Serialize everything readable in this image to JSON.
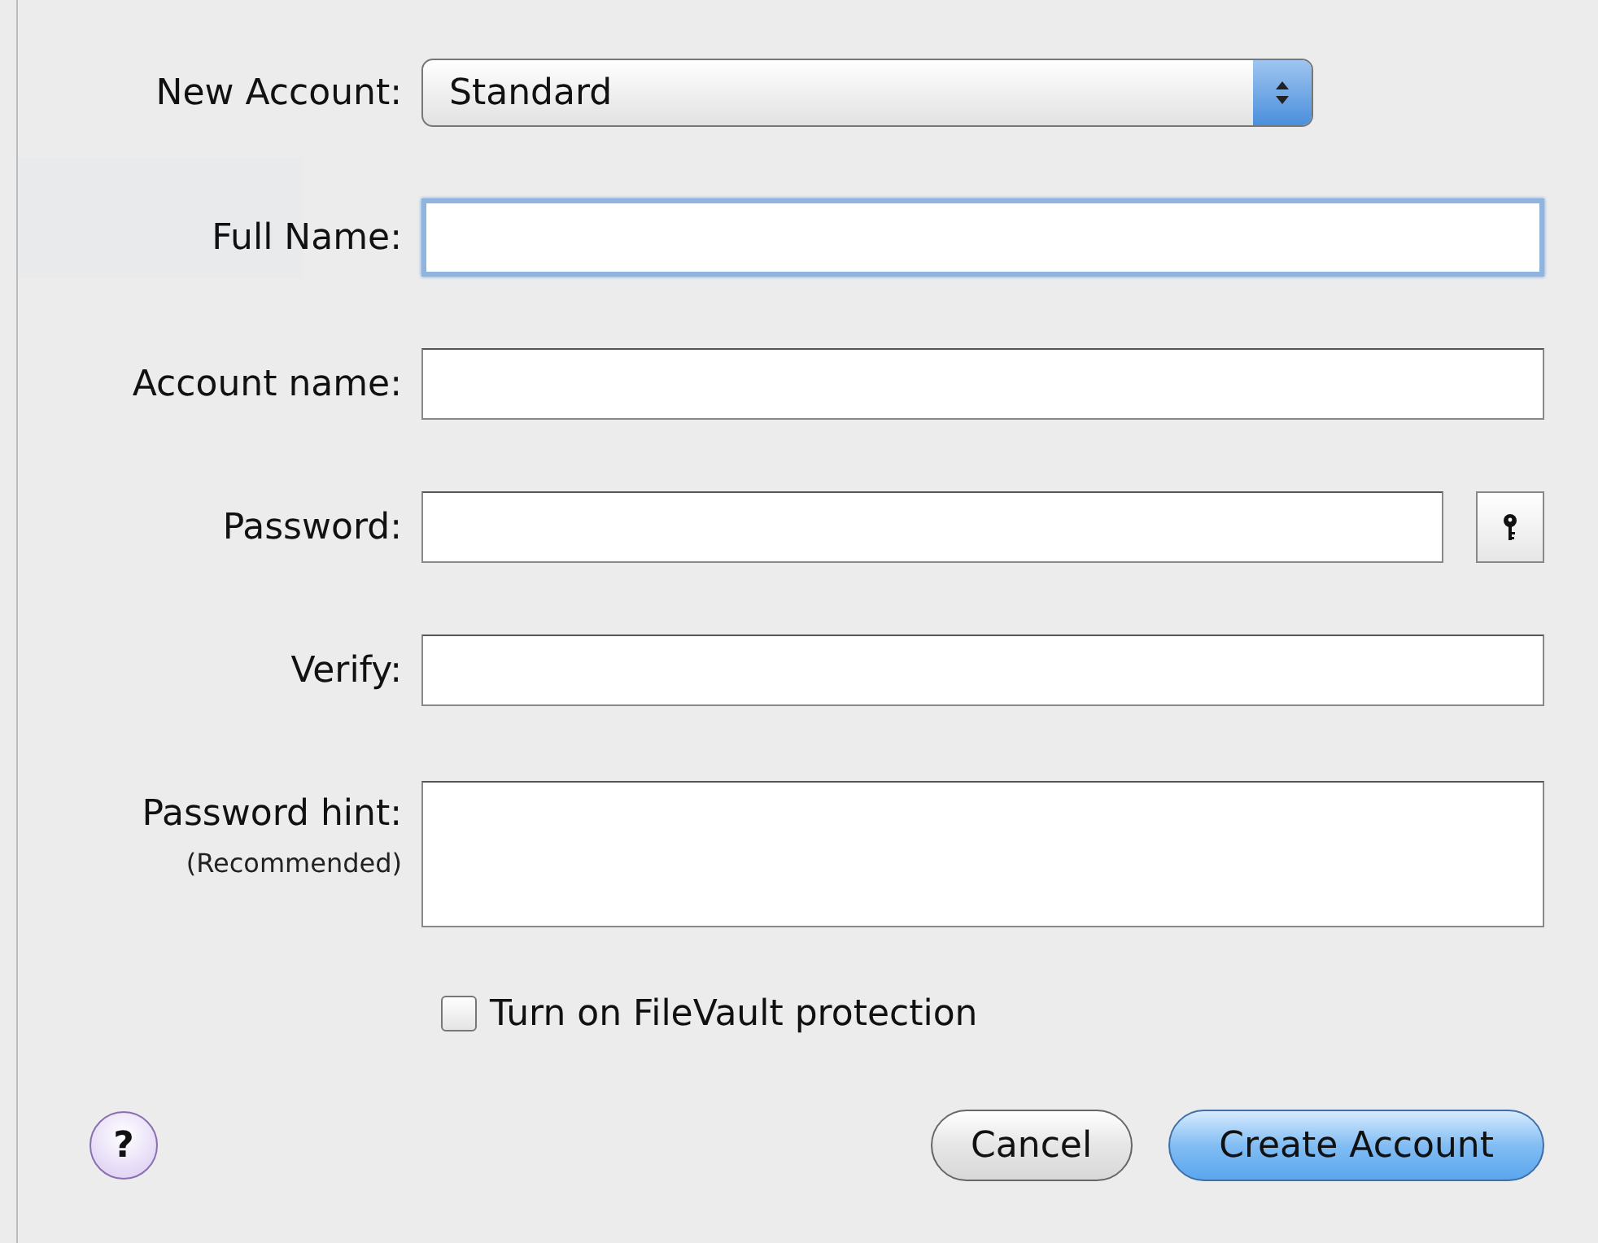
{
  "sheet": {
    "account_type": {
      "label": "New Account:",
      "value": "Standard"
    },
    "fields": [
      {
        "label": "Full Name:",
        "focused": true,
        "kind": "text"
      },
      {
        "label": "Account name:",
        "focused": false,
        "kind": "text"
      },
      {
        "label": "Password:",
        "focused": false,
        "kind": "password"
      },
      {
        "label": "Verify:",
        "focused": false,
        "kind": "text"
      },
      {
        "label": "Password hint:",
        "sublabel": "(Recommended)",
        "focused": false,
        "kind": "area"
      }
    ],
    "filevault": {
      "label": "Turn on FileVault protection",
      "checked": false
    },
    "help": "?",
    "buttons": [
      {
        "label": "Cancel",
        "default": false
      },
      {
        "label": "Create Account",
        "default": true
      }
    ]
  }
}
